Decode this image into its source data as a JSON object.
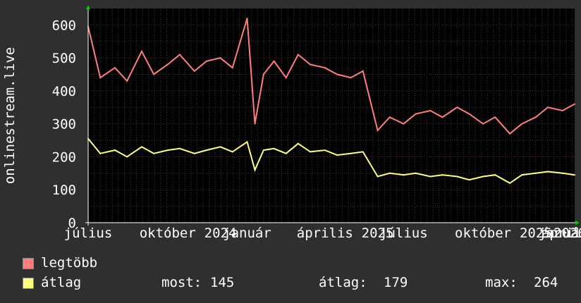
{
  "chart_data": {
    "type": "line",
    "ylabel": "onlinestream.live",
    "ylim": [
      0,
      650
    ],
    "yticks": [
      0,
      100,
      200,
      300,
      400,
      500,
      600
    ],
    "xlim": [
      "2024-07-01",
      "2026-01-15"
    ],
    "xtick_labels": [
      "július",
      "október",
      "2024",
      "január",
      "április",
      "2025",
      "július",
      "október",
      "2025",
      "január",
      "április",
      "2026"
    ],
    "xtick_dates": [
      "2024-07-01",
      "2024-10-01",
      "2024-12-01",
      "2025-01-01",
      "2025-04-01",
      "2025-06-01",
      "2025-07-01",
      "2025-10-01",
      "2025-12-01",
      "2026-01-01",
      "2026-04-01",
      "2026-06-01"
    ],
    "grid": true,
    "series": [
      {
        "name": "legtöbb",
        "color": "#ff7f7f",
        "x": [
          "2024-07-01",
          "2024-07-15",
          "2024-08-01",
          "2024-08-15",
          "2024-09-01",
          "2024-09-15",
          "2024-10-01",
          "2024-10-15",
          "2024-11-01",
          "2024-11-15",
          "2024-12-01",
          "2024-12-15",
          "2025-01-01",
          "2025-01-10",
          "2025-01-20",
          "2025-02-01",
          "2025-02-15",
          "2025-03-01",
          "2025-03-15",
          "2025-04-01",
          "2025-04-15",
          "2025-05-01",
          "2025-05-15",
          "2025-06-01",
          "2025-06-15",
          "2025-07-01",
          "2025-07-15",
          "2025-08-01",
          "2025-08-15",
          "2025-09-01",
          "2025-09-15",
          "2025-10-01",
          "2025-10-15",
          "2025-11-01",
          "2025-11-15",
          "2025-12-01",
          "2025-12-15",
          "2026-01-01",
          "2026-01-15"
        ],
        "values": [
          595,
          440,
          470,
          430,
          520,
          450,
          480,
          510,
          460,
          490,
          500,
          470,
          620,
          300,
          450,
          490,
          440,
          510,
          480,
          470,
          450,
          440,
          460,
          280,
          320,
          300,
          330,
          340,
          320,
          350,
          330,
          300,
          320,
          270,
          300,
          320,
          350,
          340,
          360
        ]
      },
      {
        "name": "átlag",
        "color": "#ffff80",
        "x": [
          "2024-07-01",
          "2024-07-15",
          "2024-08-01",
          "2024-08-15",
          "2024-09-01",
          "2024-09-15",
          "2024-10-01",
          "2024-10-15",
          "2024-11-01",
          "2024-11-15",
          "2024-12-01",
          "2024-12-15",
          "2025-01-01",
          "2025-01-10",
          "2025-01-20",
          "2025-02-01",
          "2025-02-15",
          "2025-03-01",
          "2025-03-15",
          "2025-04-01",
          "2025-04-15",
          "2025-05-01",
          "2025-05-15",
          "2025-06-01",
          "2025-06-15",
          "2025-07-01",
          "2025-07-15",
          "2025-08-01",
          "2025-08-15",
          "2025-09-01",
          "2025-09-15",
          "2025-10-01",
          "2025-10-15",
          "2025-11-01",
          "2025-11-15",
          "2025-12-01",
          "2025-12-15",
          "2026-01-01",
          "2026-01-15"
        ],
        "values": [
          255,
          210,
          220,
          200,
          230,
          210,
          220,
          225,
          210,
          220,
          230,
          215,
          245,
          160,
          220,
          225,
          210,
          240,
          215,
          220,
          205,
          210,
          215,
          140,
          150,
          145,
          150,
          140,
          145,
          140,
          130,
          140,
          145,
          120,
          145,
          150,
          155,
          150,
          145
        ]
      }
    ],
    "stats": {
      "most_label": "most:",
      "most_value": "145",
      "atlag_label": "átlag:",
      "atlag_value": "179",
      "max_label": "max:",
      "max_value": "264"
    }
  },
  "legend": {
    "max_label": "legtöbb",
    "avg_label": "átlag"
  }
}
